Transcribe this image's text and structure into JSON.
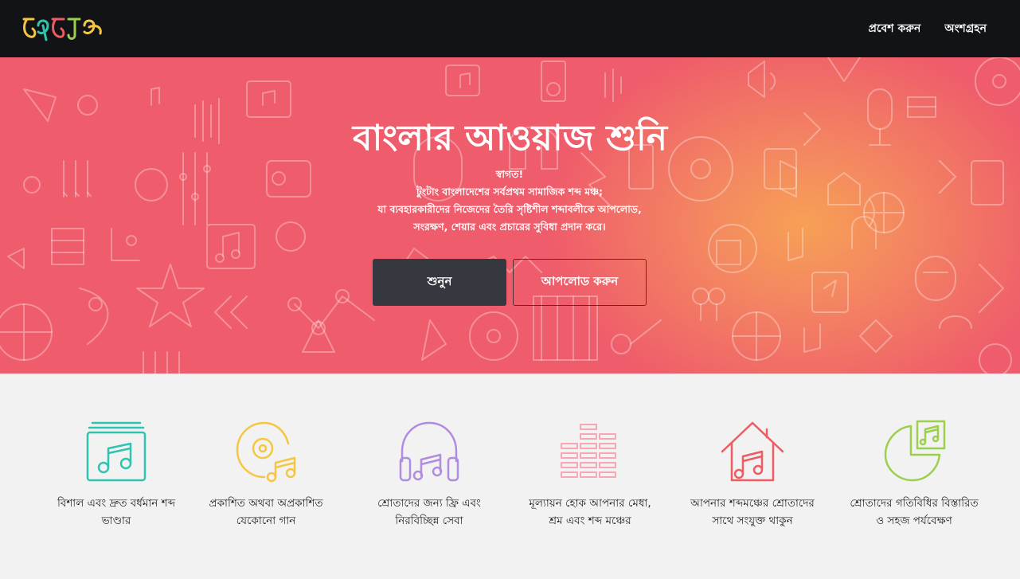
{
  "brand": {
    "logo_text": "টুংটাং"
  },
  "nav": {
    "login": "প্রবেশ করুন",
    "signup": "অংশগ্রহন"
  },
  "hero": {
    "title": "বাংলার আওয়াজ শুনি",
    "lines": [
      "স্বাগত!",
      "টুংটাং বাংলাদেশের সর্বপ্রথম সামাজিক শব্দ মঞ্চ;",
      "যা ব্যবহারকারীদের নিজেদের তৈরি সৃষ্টিশীল শব্দাবলীকে আপলোড,",
      "সংরক্ষণ, শেয়ার এবং প্রচারের সুবিধা প্রদান করে।"
    ],
    "listen_button": "শুনুন",
    "upload_button": "আপলোড করুন"
  },
  "features": [
    {
      "icon": "music-library-icon",
      "color": "#2ec4b0",
      "line1": "বিশাল এবং দ্রুত বর্ধমান শব্দ",
      "line2": "ভাণ্ডার"
    },
    {
      "icon": "disc-music-icon",
      "color": "#f6c643",
      "line1": "প্রকাশিত অথবা অপ্রকাশিত",
      "line2": "যেকোনো গান"
    },
    {
      "icon": "headphones-icon",
      "color": "#b08ce0",
      "line1": "শ্রোতাদের জন্য ফ্রি এবং",
      "line2": "নিরবিচ্ছিন্ন সেবা"
    },
    {
      "icon": "equalizer-icon",
      "color": "#f5a7b3",
      "line1": "মূল্যায়ন হোক আপনার মেধা,",
      "line2": "শ্রম এবং শব্দ মঞ্চের"
    },
    {
      "icon": "home-music-icon",
      "color": "#ee5b60",
      "line1": "আপনার শব্দমঞ্চের শ্রোতাদের",
      "line2": "সাথে সংযুক্ত থাকুন"
    },
    {
      "icon": "pie-chart-music-icon",
      "color": "#9ccf4c",
      "line1": "শ্রোতাদের গতিবিধির বিস্তারিত",
      "line2": "ও সহজ পর্যবেক্ষণ"
    }
  ]
}
